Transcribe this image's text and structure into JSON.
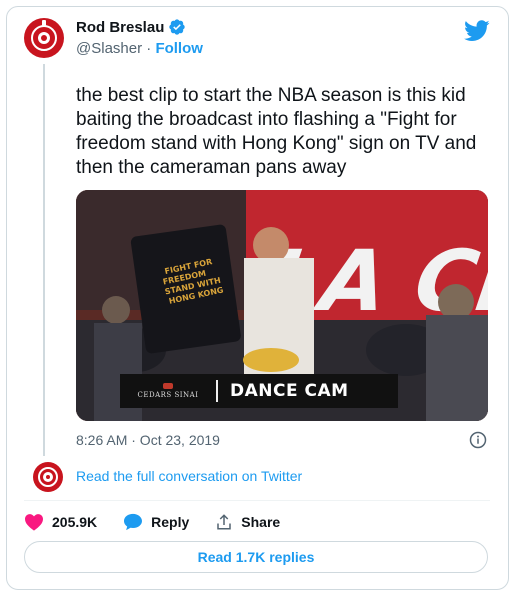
{
  "author": {
    "name": "Rod Breslau",
    "handle": "@Slasher",
    "separator": "·",
    "follow_label": "Follow",
    "verified": true
  },
  "tweet": {
    "text": "the best clip to start the NBA season is this kid baiting the broadcast into flashing a \"Fight for freedom stand with Hong Kong\" sign on TV and then the cameraman pans away",
    "timestamp": "8:26 AM · Oct 23, 2019"
  },
  "media": {
    "overlay_sponsor": "CEDARS SINAI",
    "overlay_label": "DANCE CAM",
    "sign_lines": [
      "FIGHT FOR",
      "FREEDOM",
      "STAND WITH",
      "HONG KONG"
    ],
    "banner_text": "LA CLIP"
  },
  "conversation": {
    "read_full_label": "Read the full conversation on Twitter"
  },
  "actions": {
    "likes": "205.9K",
    "reply_label": "Reply",
    "share_label": "Share"
  },
  "footer": {
    "read_replies_label": "Read 1.7K replies"
  },
  "colors": {
    "accent": "#1d9bf0",
    "like": "#f91880",
    "avatar": "#c8141e"
  },
  "icons": {
    "verified": "verified-badge-icon",
    "twitter": "twitter-bird-icon",
    "info": "info-icon",
    "like": "heart-icon",
    "reply": "speech-bubble-icon",
    "share": "share-upload-icon"
  }
}
